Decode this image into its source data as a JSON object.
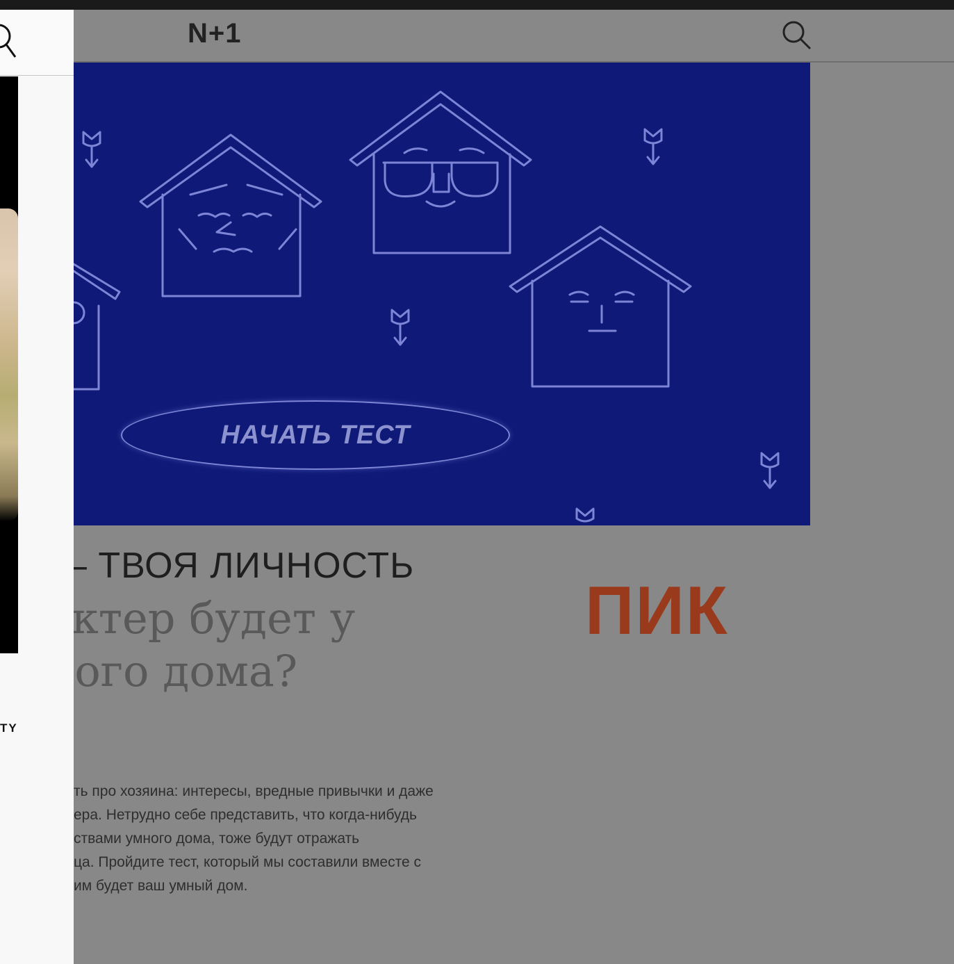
{
  "site": {
    "logo": "N+1"
  },
  "left_panel": {
    "caption_fragment": "TY"
  },
  "banner": {
    "button_label": "НАЧАТЬ ТЕСТ"
  },
  "article": {
    "kicker": "– ТВОЯ ЛИЧНОСТЬ",
    "headline_line1": "актер будет у",
    "headline_line2": "ного дома?",
    "partner_logo": "ПИК",
    "body_lines": [
      "ть про хозяина: интересы, вредные привычки и даже",
      "ера. Нетрудно себе представить, что когда-нибудь",
      "ствами умного дома, тоже будут отражать",
      "ца. Пройдите тест, который мы составили вместе с",
      "им будет ваш умный дом."
    ]
  },
  "colors": {
    "banner_bg": "#0f1a78",
    "overlay": "#888888",
    "partner_brand": "#9a3a1c",
    "line_art": "#7d86d6"
  }
}
